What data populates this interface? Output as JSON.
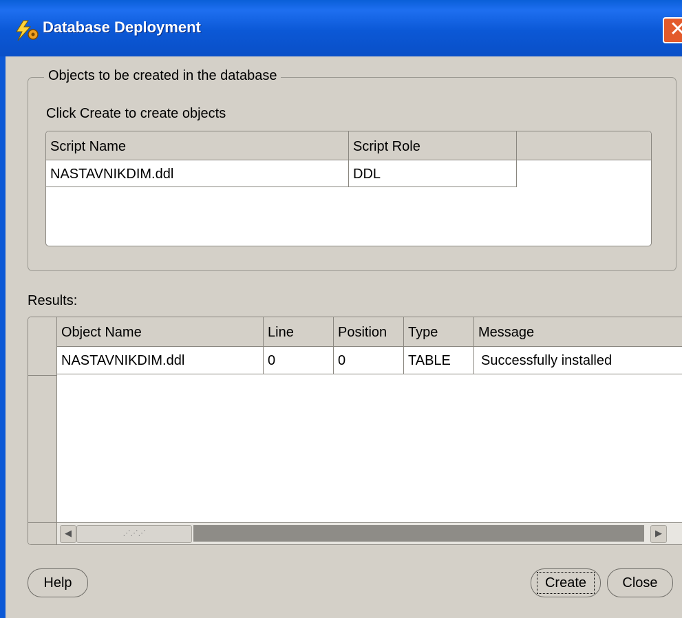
{
  "window": {
    "title": "Database Deployment",
    "close_glyph": "✕"
  },
  "objects_group": {
    "legend": "Objects to be created in the database",
    "instruction": "Click Create to create objects",
    "columns": [
      "Script Name",
      "Script Role"
    ],
    "rows": [
      [
        "NASTAVNIKDIM.ddl",
        "DDL"
      ]
    ]
  },
  "results": {
    "label": "Results:",
    "columns": [
      "Object Name",
      "Line",
      "Position",
      "Type",
      "Message"
    ],
    "rows": [
      [
        "NASTAVNIKDIM.ddl",
        "0",
        "0",
        "TABLE",
        "Successfully installed"
      ]
    ],
    "scroll_thumb_grip": "⋰⋰⋰"
  },
  "buttons": {
    "help": "Help",
    "create": "Create",
    "close": "Close"
  },
  "icons": {
    "title": "lightning-gear-icon",
    "scroll_left": "◀",
    "scroll_right": "▶"
  },
  "colors": {
    "titlebar": "#0b58d6",
    "close_button": "#e35a2b",
    "dialog": "#d4d0c8"
  }
}
